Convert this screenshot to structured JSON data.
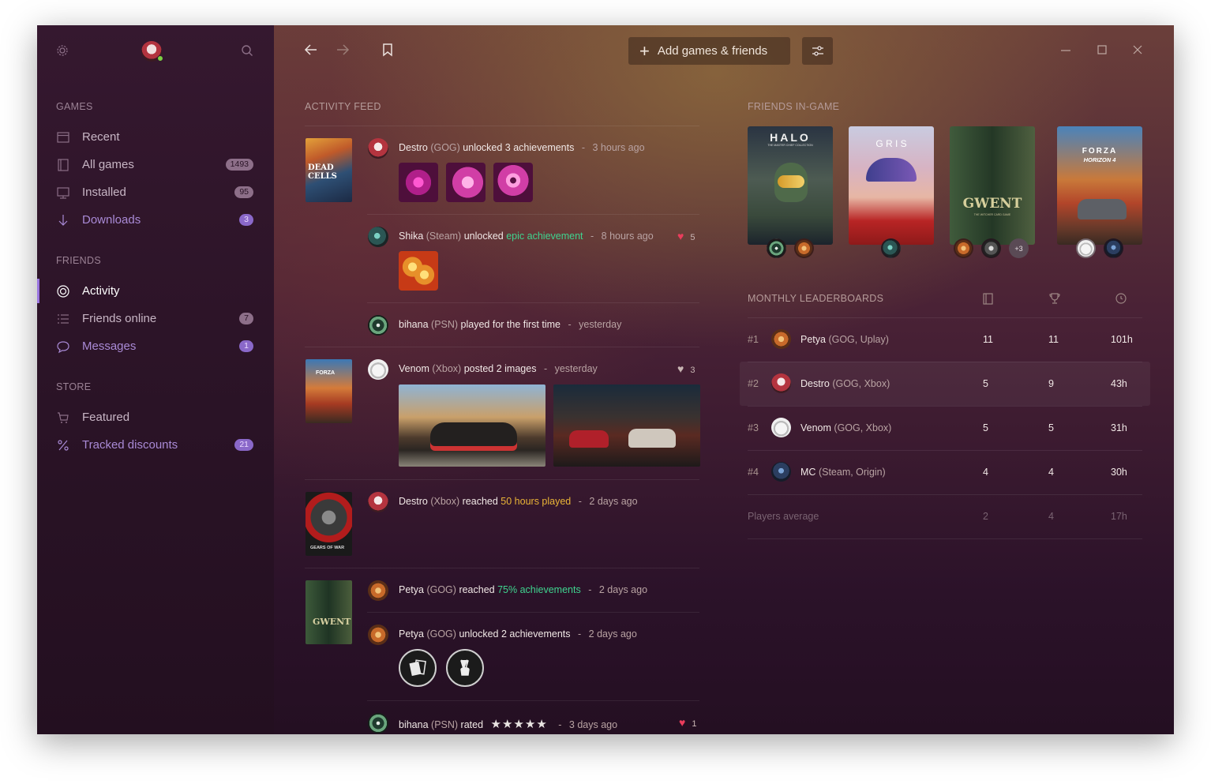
{
  "sidebar": {
    "games_title": "GAMES",
    "games": [
      {
        "label": "Recent",
        "icon": "calendar-icon",
        "badge": ""
      },
      {
        "label": "All games",
        "icon": "book-icon",
        "badge": "1493"
      },
      {
        "label": "Installed",
        "icon": "monitor-icon",
        "badge": "95"
      },
      {
        "label": "Downloads",
        "icon": "download-icon",
        "badge": "3"
      }
    ],
    "friends_title": "FRIENDS",
    "friends": [
      {
        "label": "Activity",
        "icon": "activity-icon",
        "badge": ""
      },
      {
        "label": "Friends online",
        "icon": "list-icon",
        "badge": "7"
      },
      {
        "label": "Messages",
        "icon": "chat-icon",
        "badge": "1"
      }
    ],
    "store_title": "STORE",
    "store": [
      {
        "label": "Featured",
        "icon": "cart-icon",
        "badge": ""
      },
      {
        "label": "Tracked discounts",
        "icon": "percent-icon",
        "badge": "21"
      }
    ]
  },
  "toolbar": {
    "add_label": "Add games & friends"
  },
  "feed": {
    "title": "ACTIVITY FEED",
    "entries": [
      {
        "user": "Destro",
        "platform": "(GOG)",
        "action": "unlocked 3 achievements",
        "time": "3 hours ago"
      },
      {
        "user": "Shika",
        "platform": "(Steam)",
        "action": "unlocked",
        "highlight": "epic achievement",
        "time": "8 hours ago",
        "likes": "5"
      },
      {
        "user": "bihana",
        "platform": "(PSN)",
        "action": "played for the first time",
        "time": "yesterday"
      },
      {
        "user": "Venom",
        "platform": "(Xbox)",
        "action": "posted 2 images",
        "time": "yesterday",
        "likes": "3"
      },
      {
        "user": "Destro",
        "platform": "(Xbox)",
        "action": "reached",
        "highlight": "50 hours played",
        "time": "2 days ago"
      },
      {
        "user": "Petya",
        "platform": "(GOG)",
        "action": "reached",
        "highlight": "75% achievements",
        "time": "2 days ago"
      },
      {
        "user": "Petya",
        "platform": "(GOG)",
        "action": "unlocked 2 achievements",
        "time": "2 days ago"
      },
      {
        "user": "bihana",
        "platform": "(PSN)",
        "action": "rated",
        "stars": "★★★★★",
        "time": "3 days ago",
        "likes": "1"
      }
    ],
    "sep": "-"
  },
  "friends_in_game": {
    "title": "FRIENDS IN-GAME",
    "covers": [
      {
        "title": "HALO",
        "subtitle": "THE MASTER CHIEF COLLECTION"
      },
      {
        "title": "G R I S"
      },
      {
        "title": "GWENT",
        "subtitle": "THE WITCHER CARD GAME"
      },
      {
        "title": "FORZA",
        "subtitle": "HORIZON 4"
      }
    ],
    "more": "+3"
  },
  "covers_small": {
    "deadcells": "DEAD CELLS",
    "forza": "FORZA",
    "gears": "GEARS OF WAR",
    "gwent": "GWENT"
  },
  "leaderboard": {
    "title": "MONTHLY LEADERBOARDS",
    "rows": [
      {
        "rank": "#1",
        "name": "Petya",
        "platforms": "(GOG, Uplay)",
        "games": "11",
        "achievements": "11",
        "hours": "101h"
      },
      {
        "rank": "#2",
        "name": "Destro",
        "platforms": "(GOG, Xbox)",
        "games": "5",
        "achievements": "9",
        "hours": "43h"
      },
      {
        "rank": "#3",
        "name": "Venom",
        "platforms": "(GOG, Xbox)",
        "games": "5",
        "achievements": "5",
        "hours": "31h"
      },
      {
        "rank": "#4",
        "name": "MC",
        "platforms": "(Steam, Origin)",
        "games": "4",
        "achievements": "4",
        "hours": "30h"
      }
    ],
    "average": {
      "label": "Players average",
      "games": "2",
      "achievements": "4",
      "hours": "17h"
    }
  },
  "colors": {
    "accent": "#9a76e0",
    "like": "#ea3d5c",
    "achievement": "#3fd48f",
    "hours": "#e9b437"
  }
}
